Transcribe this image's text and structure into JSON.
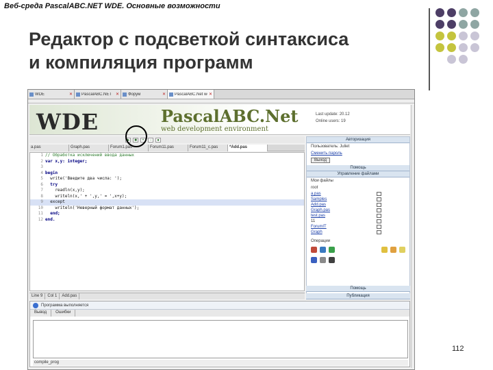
{
  "slide": {
    "header": "Веб-среда PascalABC.NET WDE. Основные возможности",
    "title_line1": "Редактор с подсветкой синтаксиса",
    "title_line2": "и компиляция программ",
    "page_number": "112",
    "accent_colors": {
      "purple": "#4d3e66",
      "teal": "#8fa6a3",
      "olive": "#c4c43e",
      "lavender": "#c9c5d6"
    }
  },
  "screenshot": {
    "browser_tabs": [
      {
        "label": "WDE"
      },
      {
        "label": "PascalABC.NET"
      },
      {
        "label": "Форум"
      },
      {
        "label": "PascalABC.Net web development"
      }
    ],
    "banner": {
      "logo": "WDE",
      "pascal_logo": "PascalABC.Net",
      "subtitle": "web development environment",
      "info_line1": "Last update: 20.12",
      "info_line2": "Online users: 19"
    },
    "toolbar_buttons": [
      "▶",
      "■",
      "+",
      "−",
      "●"
    ],
    "file_tabs": [
      "a.pas",
      "Graph.pas",
      "Forum1.pas",
      "Forum11.pas",
      "Forum11_c.pas",
      "*Add.pas"
    ],
    "code_lines": [
      {
        "n": "1",
        "text": "// Обработка исключений ввода данных",
        "kind": "comment"
      },
      {
        "n": "2",
        "text": "var x,y: integer;",
        "kind": "kw"
      },
      {
        "n": "3",
        "text": "",
        "kind": "plain"
      },
      {
        "n": "4",
        "text": "begin",
        "kind": "kw"
      },
      {
        "n": "5",
        "text": "  write('Введите два числа: ');",
        "kind": "plain"
      },
      {
        "n": "6",
        "text": "  try",
        "kind": "kw"
      },
      {
        "n": "7",
        "text": "    readln(x,y);",
        "kind": "plain"
      },
      {
        "n": "8",
        "text": "    writeln(x,' + ',y,' = ',x+y);",
        "kind": "plain"
      },
      {
        "n": "9",
        "text": "  except",
        "kind": "hl"
      },
      {
        "n": "10",
        "text": "    writeln('Неверный формат данных');",
        "kind": "plain"
      },
      {
        "n": "11",
        "text": "  end;",
        "kind": "kw"
      },
      {
        "n": "12",
        "text": "end.",
        "kind": "kw"
      }
    ],
    "statusbar": [
      "Line 9",
      "Col 1",
      "Add.pas"
    ],
    "output": {
      "header": "Программа выполняется",
      "tabs": [
        "Вывод",
        "Ошибки"
      ],
      "status": "compile_prog"
    },
    "sidebar": {
      "auth_head": "Авторизация",
      "welcome": "Пользователь: Juliet",
      "change_pass": "Сменить пароль",
      "exit_btn": "Выход",
      "help_head": "Помощь",
      "files_head": "Управление файлами",
      "my_files": "Мои файлы",
      "root": "root",
      "tree": [
        {
          "name": "a.pas",
          "link": true
        },
        {
          "name": "Samples",
          "link": true
        },
        {
          "name": "Add.pas",
          "link": true
        },
        {
          "name": "Graph.pas",
          "link": true
        },
        {
          "name": "test.pas",
          "link": true
        },
        {
          "name": "11",
          "link": false
        },
        {
          "name": "ForumIT",
          "link": true
        },
        {
          "name": "Graph",
          "link": true
        }
      ],
      "ops": "Операции",
      "tools_head": "Помощь",
      "publish_head": "Публикация"
    }
  }
}
